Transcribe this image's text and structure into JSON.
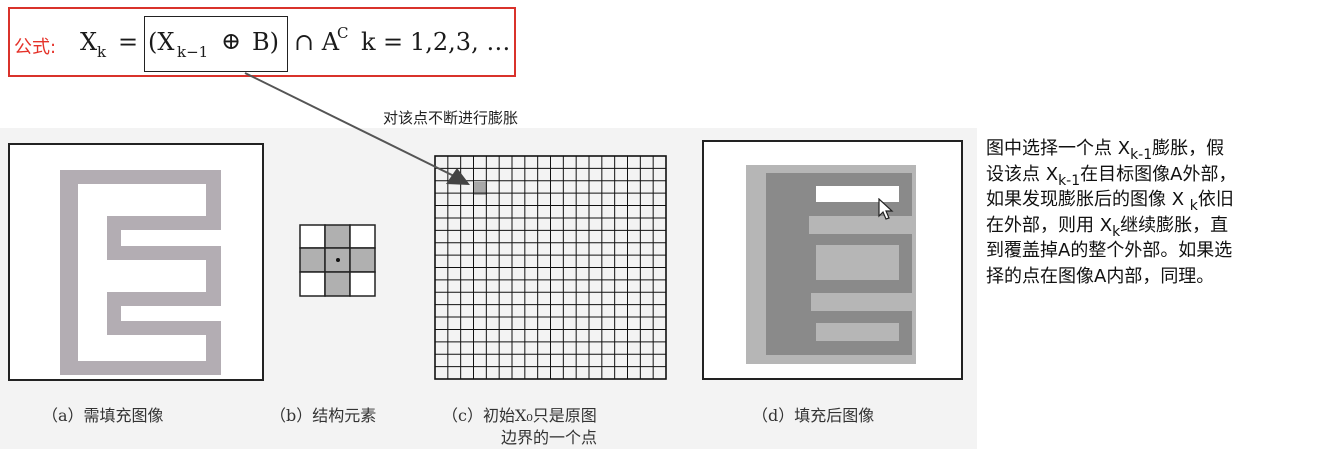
{
  "formula": {
    "label": "公式:",
    "xk": "X",
    "k_sub": "k",
    "equals1": "=",
    "open": "(X",
    "km1_sub": "k−1",
    "oplus": "⊕",
    "b_close": "B)",
    "cap": "∩ A",
    "c_sup": "C",
    "k_text": "k",
    "equals2": "=",
    "range": "1,2,3, …"
  },
  "annotation": "对该点不断进行膨胀",
  "captions": {
    "a": "（a）需填充图像",
    "b": "（b）结构元素",
    "c_line1": "（c）初始X₀只是原图",
    "c_line2": "边界的一个点",
    "d": "（d）填充后图像"
  },
  "description": {
    "l1a": "图中选择一个点 X",
    "l1s": "k-1",
    "l1b": "膨胀，假",
    "l2a": "设该点 X",
    "l2s": "k-1",
    "l2b": "在目标图像A外部，",
    "l3a": "如果发现膨胀后的图像 X ",
    "l3s": "k",
    "l3b": "依旧",
    "l4a": "在外部，则用 X",
    "l4s": "k",
    "l4b": "继续膨胀，直",
    "l5": "到覆盖掉A的整个外部。如果选",
    "l6": "择的点在图像A内部，同理。"
  },
  "colors": {
    "accent_red": "#d9322b",
    "shape_gray": "#b3adb3",
    "fill_light": "#b6b6b6",
    "fill_dark": "#8a8a8a"
  },
  "icons": [
    "mouse-cursor-icon",
    "pointer-arrow-icon"
  ]
}
